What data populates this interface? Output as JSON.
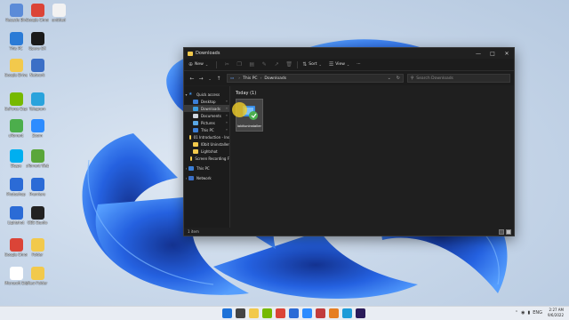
{
  "desktop": {
    "icons": [
      {
        "label": "Recycle Bin",
        "icon": "recycle-bin-icon",
        "color": "#5b8bd8"
      },
      {
        "label": "Google Chrome",
        "icon": "chrome-icon",
        "color": "#db4437"
      },
      {
        "label": "untitled",
        "icon": "file-icon",
        "color": "#f2f2f2"
      },
      {
        "label": "This PC",
        "icon": "monitor-icon",
        "color": "#2b7bd6"
      },
      {
        "label": "Opera GX",
        "icon": "opera-icon",
        "color": "#1a1a1a"
      },
      {
        "label": "Google Drive",
        "icon": "folder-icon",
        "color": "#f2c94c"
      },
      {
        "label": "Network",
        "icon": "network-icon",
        "color": "#3b6fc6"
      },
      {
        "label": "GeForce Experience",
        "icon": "nvidia-icon",
        "color": "#76b900"
      },
      {
        "label": "Telegram",
        "icon": "telegram-icon",
        "color": "#2aa3dc"
      },
      {
        "label": "uTorrent",
        "icon": "utorrent-icon",
        "color": "#4cae4c"
      },
      {
        "label": "Zoom",
        "icon": "zoom-icon",
        "color": "#2d8cff"
      },
      {
        "label": "Skype",
        "icon": "skype-icon",
        "color": "#00aff0"
      },
      {
        "label": "uTorrent Web",
        "icon": "utorrent-web-icon",
        "color": "#5aa63a"
      },
      {
        "label": "Photoshop",
        "icon": "photoshop-icon",
        "color": "#2b6bd6"
      },
      {
        "label": "Premiere",
        "icon": "premiere-icon",
        "color": "#2b6bd6"
      },
      {
        "label": "Lightshot",
        "icon": "bluetooth-icon",
        "color": "#2b6bd6"
      },
      {
        "label": "OBS Studio",
        "icon": "obs-icon",
        "color": "#222222"
      },
      {
        "label": "Google Chrome",
        "icon": "chrome-icon",
        "color": "#db4437"
      },
      {
        "label": "Folder",
        "icon": "folder-icon",
        "color": "#f2c94c"
      },
      {
        "label": "Microsoft Edge",
        "icon": "edge-icon",
        "color": "#ffffff"
      },
      {
        "label": "New Folder",
        "icon": "folder-icon",
        "color": "#f2c94c"
      }
    ]
  },
  "explorer": {
    "title": "Downloads",
    "commands": {
      "new": "New",
      "sort": "Sort",
      "view": "View",
      "more": "···"
    },
    "address": {
      "root": "This PC",
      "current": "Downloads"
    },
    "search_placeholder": "Search Downloads",
    "nav": {
      "quick_access": "Quick access",
      "items": [
        {
          "label": "Desktop",
          "color": "#3b7ed6",
          "pinned": true
        },
        {
          "label": "Downloads",
          "color": "#3b9de0",
          "pinned": true,
          "selected": true
        },
        {
          "label": "Documents",
          "color": "#cfd6df",
          "pinned": true
        },
        {
          "label": "Pictures",
          "color": "#5aa8e6",
          "pinned": true
        },
        {
          "label": "This PC",
          "color": "#3b7ed6",
          "pinned": true
        },
        {
          "label": "01 Introduction - Ins",
          "color": "#f2c94c",
          "pinned": false
        },
        {
          "label": "IObit Uninstaller",
          "color": "#f2c94c",
          "pinned": false
        },
        {
          "label": "Lightshot",
          "color": "#f2c94c",
          "pinned": false
        },
        {
          "label": "Screen Recording F",
          "color": "#f2c94c",
          "pinned": false
        }
      ],
      "this_pc": "This PC",
      "network": "Network"
    },
    "group": {
      "name": "Today",
      "count": "(1)"
    },
    "file": {
      "name": "iobituninstaller"
    },
    "status": {
      "items": "1 item"
    }
  },
  "taskbar": {
    "apps": [
      {
        "icon": "start-icon",
        "color": "#1e72d8"
      },
      {
        "icon": "search-icon",
        "color": "#444444"
      },
      {
        "icon": "file-explorer-icon",
        "color": "#f2c94c"
      },
      {
        "icon": "nvidia-icon",
        "color": "#76b900"
      },
      {
        "icon": "chrome-icon",
        "color": "#db4437"
      },
      {
        "icon": "store-icon",
        "color": "#2b6bd6"
      },
      {
        "icon": "zoom-icon",
        "color": "#2d8cff"
      },
      {
        "icon": "camera-icon",
        "color": "#c13c3c"
      },
      {
        "icon": "vlc-icon",
        "color": "#e67e22"
      },
      {
        "icon": "edge-icon",
        "color": "#1e9bd8"
      },
      {
        "icon": "premiere-icon",
        "color": "#2a1b5a"
      }
    ],
    "tray": {
      "lang": "ENG",
      "time": "2:27 AM",
      "date": "9/6/2022"
    }
  }
}
